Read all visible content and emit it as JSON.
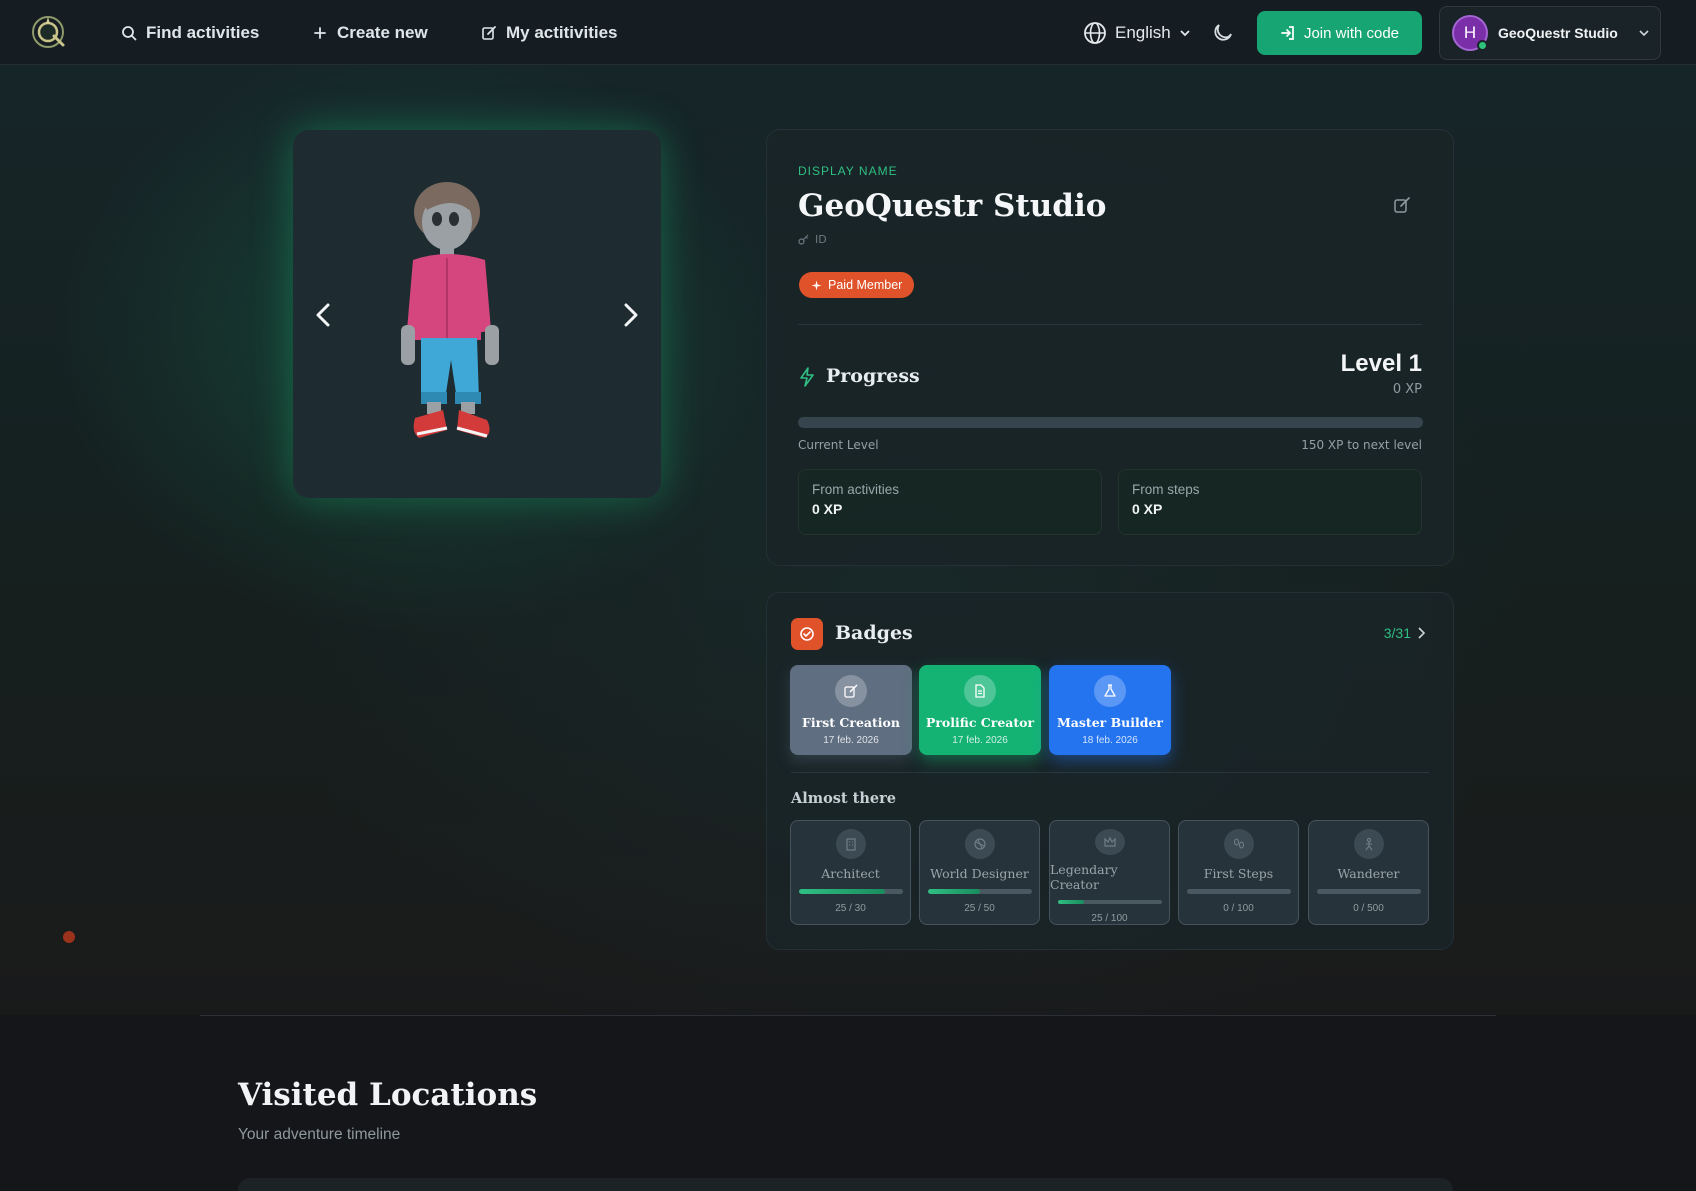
{
  "nav": {
    "find_label": "Find activities",
    "create_label": "Create new",
    "my_label": "My actitivities",
    "language": "English",
    "join_label": "Join with code",
    "user_initial": "H",
    "user_name": "GeoQuestr Studio"
  },
  "profile": {
    "display_name_label": "DISPLAY NAME",
    "display_name": "GeoQuestr Studio",
    "id_label": "ID",
    "member_badge": "Paid Member",
    "progress_title": "Progress",
    "level": "Level 1",
    "xp": "0 XP",
    "progress_fraction": 0,
    "current_level_label": "Current Level",
    "next_level_label": "150 XP to next level",
    "from_activities_label": "From activities",
    "from_activities_value": "0 XP",
    "from_steps_label": "From steps",
    "from_steps_value": "0 XP"
  },
  "badges": {
    "title": "Badges",
    "count": "3/31",
    "earned": [
      {
        "name": "First Creation",
        "date": "17 feb. 2026",
        "color": "#5f6e80",
        "icon": "pencil-icon"
      },
      {
        "name": "Prolific Creator",
        "date": "17 feb. 2026",
        "color": "#14b374",
        "icon": "document-icon"
      },
      {
        "name": "Master Builder",
        "date": "18 feb. 2026",
        "color": "#2474f0",
        "icon": "flask-icon"
      }
    ],
    "almost_title": "Almost there",
    "almost": [
      {
        "name": "Architect",
        "progress": "25 / 30",
        "fraction": 0.83
      },
      {
        "name": "World Designer",
        "progress": "25 / 50",
        "fraction": 0.5
      },
      {
        "name": "Legendary Creator",
        "progress": "25 / 100",
        "fraction": 0.25
      },
      {
        "name": "First Steps",
        "progress": "0 / 100",
        "fraction": 0
      },
      {
        "name": "Wanderer",
        "progress": "0 / 500",
        "fraction": 0
      }
    ]
  },
  "visited": {
    "title": "Visited Locations",
    "subtitle": "Your adventure timeline"
  },
  "colors": {
    "accent": "#17a673",
    "member": "#e0522a"
  }
}
